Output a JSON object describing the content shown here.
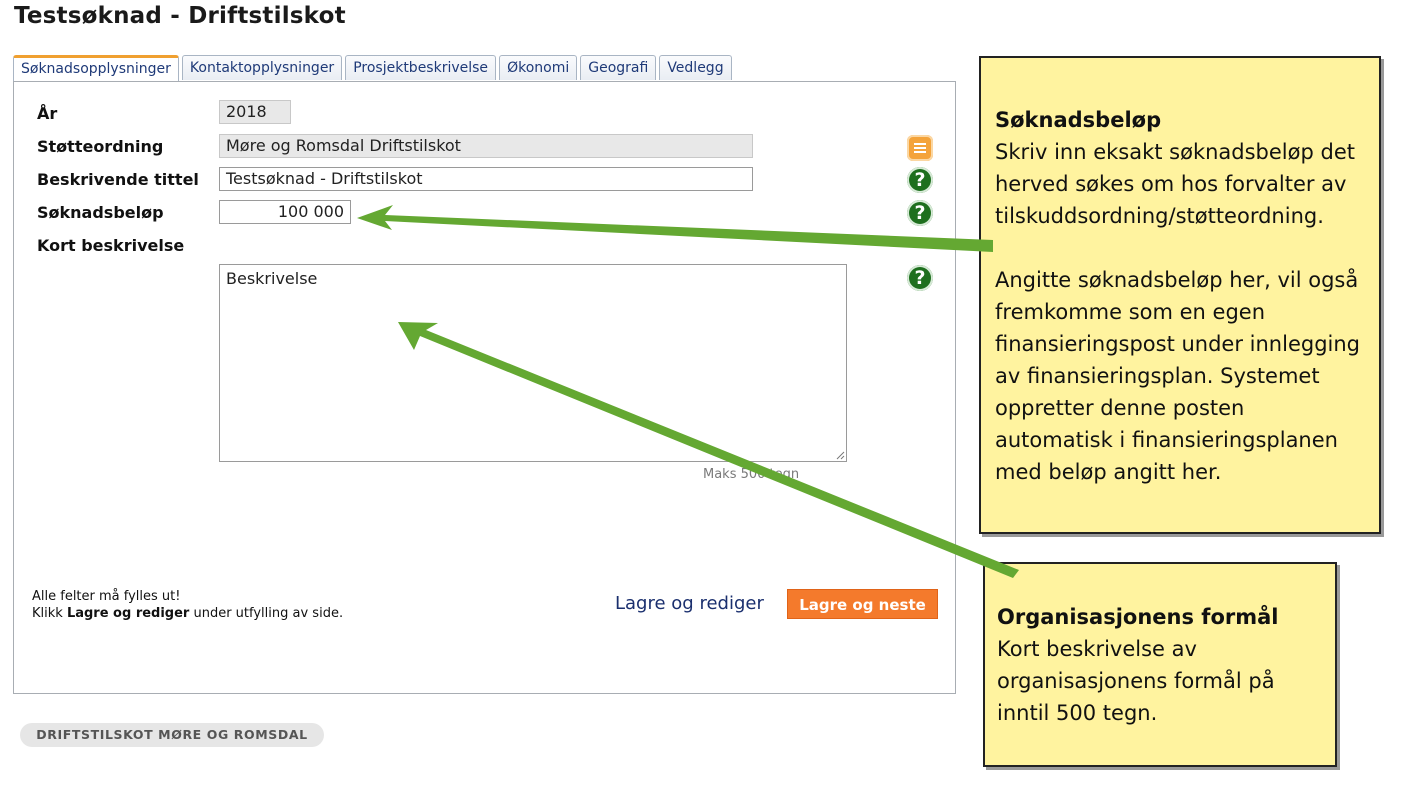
{
  "page": {
    "title": "Testsøknad - Driftstilskot"
  },
  "tabs": [
    {
      "label": "Søknadsopplysninger",
      "active": true
    },
    {
      "label": "Kontaktopplysninger",
      "active": false
    },
    {
      "label": "Prosjektbeskrivelse",
      "active": false
    },
    {
      "label": "Økonomi",
      "active": false
    },
    {
      "label": "Geografi",
      "active": false
    },
    {
      "label": "Vedlegg",
      "active": false
    }
  ],
  "form": {
    "ar_label": "År",
    "ar_value": "2018",
    "stotteordning_label": "Støtteordning",
    "stotteordning_value": "Møre og Romsdal Driftstilskot",
    "tittel_label": "Beskrivende tittel",
    "tittel_value": "Testsøknad - Driftstilskot",
    "belop_label": "Søknadsbeløp",
    "belop_value": "100 000",
    "kort_label": "Kort beskrivelse",
    "kort_value": "Beskrivelse",
    "maks": "Maks 500 tegn"
  },
  "footer": {
    "line1": "Alle felter må fylles ut!",
    "line2_prefix": "Klikk ",
    "line2_bold": "Lagre og rediger",
    "line2_suffix": " under utfylling av side.",
    "lagre_rediger": "Lagre og rediger",
    "lagre_neste": "Lagre og neste"
  },
  "bottom_pill": "DRIFTSTILSKOT MØRE OG ROMSDAL",
  "callouts": {
    "belop": {
      "title": "Søknadsbeløp",
      "text1": "Skriv inn eksakt søknadsbeløp det herved søkes om hos forvalter av tilskuddsordning/støtteordning.",
      "text2": "Angitte søknadsbeløp her, vil også fremkomme som en egen finansieringspost under innlegging av finansieringsplan. Systemet oppretter denne posten automatisk i finansieringsplanen med beløp angitt her."
    },
    "formal": {
      "title": "Organisasjonens formål",
      "text": "Kort beskrivelse av organisasjonens formål på inntil 500 tegn."
    }
  },
  "icons": {
    "help": "?",
    "note": "note-icon"
  },
  "colors": {
    "accent": "#f47a2c",
    "help": "#1e6f1e",
    "callout_bg": "#fff39f",
    "arrow": "#64a832"
  }
}
